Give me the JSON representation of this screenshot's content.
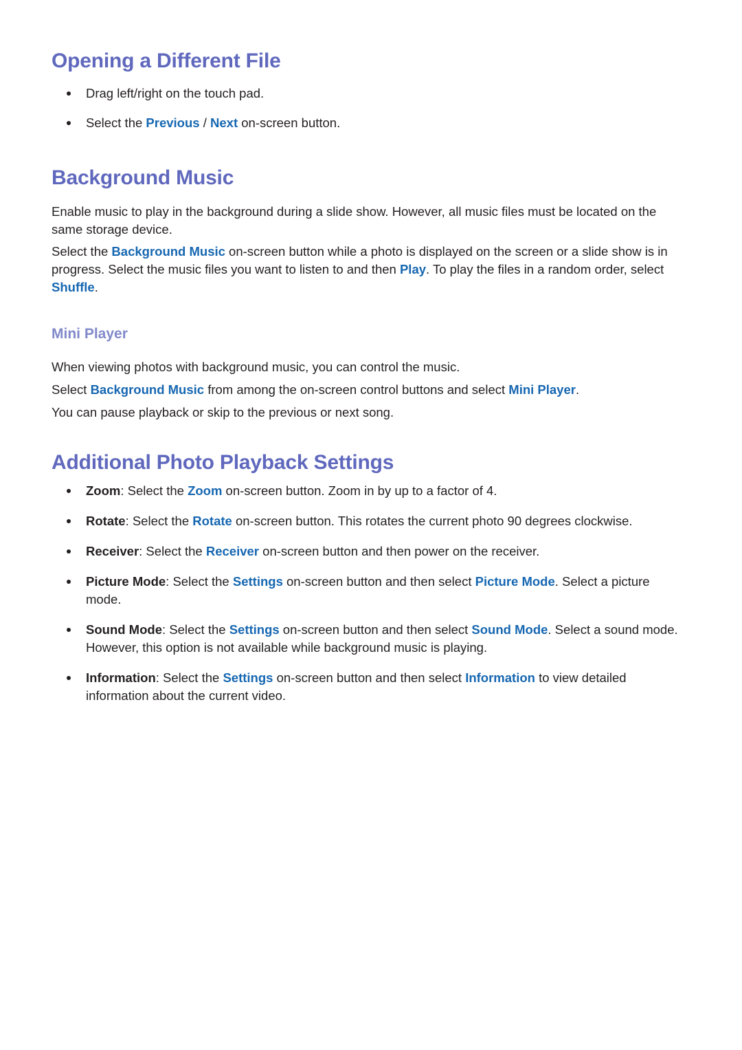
{
  "document": {
    "sections": [
      {
        "id": "opening-a-different-file",
        "heading": "Opening a Different File",
        "bullets": [
          {
            "parts": [
              {
                "t": "Drag left/right on the touch pad.",
                "s": "plain"
              }
            ]
          },
          {
            "parts": [
              {
                "t": "Select the ",
                "s": "plain"
              },
              {
                "t": "Previous",
                "s": "accent"
              },
              {
                "t": " / ",
                "s": "plain"
              },
              {
                "t": "Next",
                "s": "accent"
              },
              {
                "t": " on-screen button.",
                "s": "plain"
              }
            ]
          }
        ]
      },
      {
        "id": "background-music",
        "heading": "Background Music",
        "paragraphs": [
          {
            "parts": [
              {
                "t": "Enable music to play in the background during a slide show. However, all music files must be located on the same storage device.",
                "s": "plain"
              }
            ]
          },
          {
            "parts": [
              {
                "t": "Select the ",
                "s": "plain"
              },
              {
                "t": "Background Music",
                "s": "accent"
              },
              {
                "t": " on-screen button while a photo is displayed on the screen or a slide show is in progress. Select the music files you want to listen to and then ",
                "s": "plain"
              },
              {
                "t": "Play",
                "s": "accent"
              },
              {
                "t": ". To play the files in a random order, select ",
                "s": "plain"
              },
              {
                "t": "Shuffle",
                "s": "accent"
              },
              {
                "t": ".",
                "s": "plain"
              }
            ]
          }
        ],
        "subsection": {
          "id": "mini-player",
          "heading": "Mini Player",
          "paragraphs": [
            {
              "parts": [
                {
                  "t": "When viewing photos with background music, you can control the music.",
                  "s": "plain"
                }
              ]
            },
            {
              "parts": [
                {
                  "t": "Select ",
                  "s": "plain"
                },
                {
                  "t": "Background Music",
                  "s": "accent"
                },
                {
                  "t": " from among the on-screen control buttons and select ",
                  "s": "plain"
                },
                {
                  "t": "Mini Player",
                  "s": "accent"
                },
                {
                  "t": ".",
                  "s": "plain"
                }
              ]
            },
            {
              "parts": [
                {
                  "t": "You can pause playback or skip to the previous or next song.",
                  "s": "plain"
                }
              ]
            }
          ]
        }
      },
      {
        "id": "additional-photo-playback-settings",
        "heading": "Additional Photo Playback Settings",
        "bullets": [
          {
            "parts": [
              {
                "t": "Zoom",
                "s": "term"
              },
              {
                "t": ": Select the ",
                "s": "plain"
              },
              {
                "t": "Zoom",
                "s": "accent"
              },
              {
                "t": " on-screen button. Zoom in by up to a factor of 4.",
                "s": "plain"
              }
            ]
          },
          {
            "parts": [
              {
                "t": "Rotate",
                "s": "term"
              },
              {
                "t": ": Select the ",
                "s": "plain"
              },
              {
                "t": "Rotate",
                "s": "accent"
              },
              {
                "t": " on-screen button. This rotates the current photo 90 degrees clockwise.",
                "s": "plain"
              }
            ]
          },
          {
            "parts": [
              {
                "t": "Receiver",
                "s": "term"
              },
              {
                "t": ": Select the ",
                "s": "plain"
              },
              {
                "t": "Receiver",
                "s": "accent"
              },
              {
                "t": " on-screen button and then power on the receiver.",
                "s": "plain"
              }
            ]
          },
          {
            "parts": [
              {
                "t": "Picture Mode",
                "s": "term"
              },
              {
                "t": ": Select the ",
                "s": "plain"
              },
              {
                "t": "Settings",
                "s": "accent"
              },
              {
                "t": " on-screen button and then select ",
                "s": "plain"
              },
              {
                "t": "Picture Mode",
                "s": "accent"
              },
              {
                "t": ". Select a picture mode.",
                "s": "plain"
              }
            ]
          },
          {
            "parts": [
              {
                "t": "Sound Mode",
                "s": "term"
              },
              {
                "t": ": Select the ",
                "s": "plain"
              },
              {
                "t": "Settings",
                "s": "accent"
              },
              {
                "t": " on-screen button and then select ",
                "s": "plain"
              },
              {
                "t": "Sound Mode",
                "s": "accent"
              },
              {
                "t": ". Select a sound mode. However, this option is not available while background music is playing.",
                "s": "plain"
              }
            ]
          },
          {
            "parts": [
              {
                "t": "Information",
                "s": "term"
              },
              {
                "t": ": Select the ",
                "s": "plain"
              },
              {
                "t": "Settings",
                "s": "accent"
              },
              {
                "t": " on-screen button and then select ",
                "s": "plain"
              },
              {
                "t": "Information",
                "s": "accent"
              },
              {
                "t": " to view detailed information about the current video.",
                "s": "plain"
              }
            ]
          }
        ]
      }
    ]
  },
  "colors": {
    "heading": "#5f68bd",
    "subheading": "#8189ca",
    "accent": "#1667b1",
    "body": "#231f20",
    "background": "#ffffff"
  }
}
